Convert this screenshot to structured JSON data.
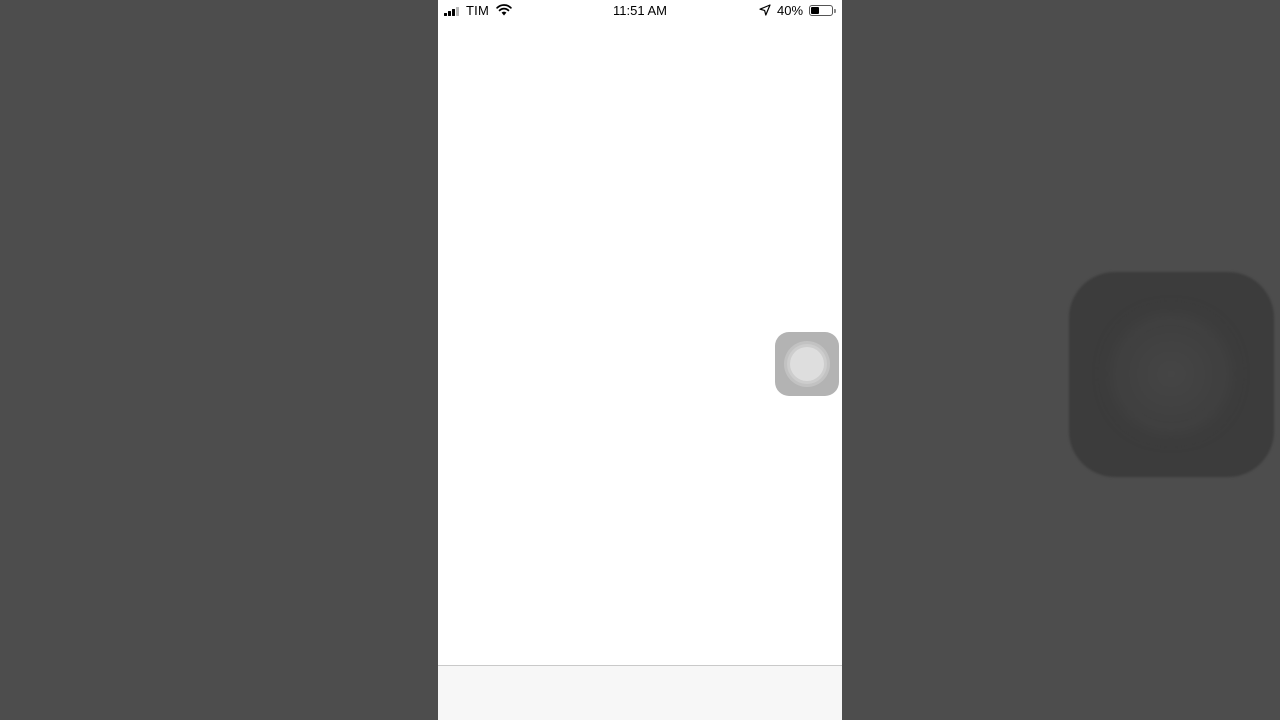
{
  "status_bar": {
    "carrier": "TIM",
    "time": "11:51 AM",
    "battery_percent": "40%",
    "battery_level": 0.4,
    "signal_bars_filled": 3,
    "signal_bars_total": 4,
    "icons": [
      "signal-icon",
      "wifi-icon",
      "location-arrow-icon",
      "battery-icon"
    ]
  },
  "assistive_touch": {
    "icon": "assistive-touch-icon"
  },
  "colors": {
    "background_dim": "#4d4d4d",
    "screen": "#ffffff",
    "bottom_bar": "#f7f7f7"
  }
}
